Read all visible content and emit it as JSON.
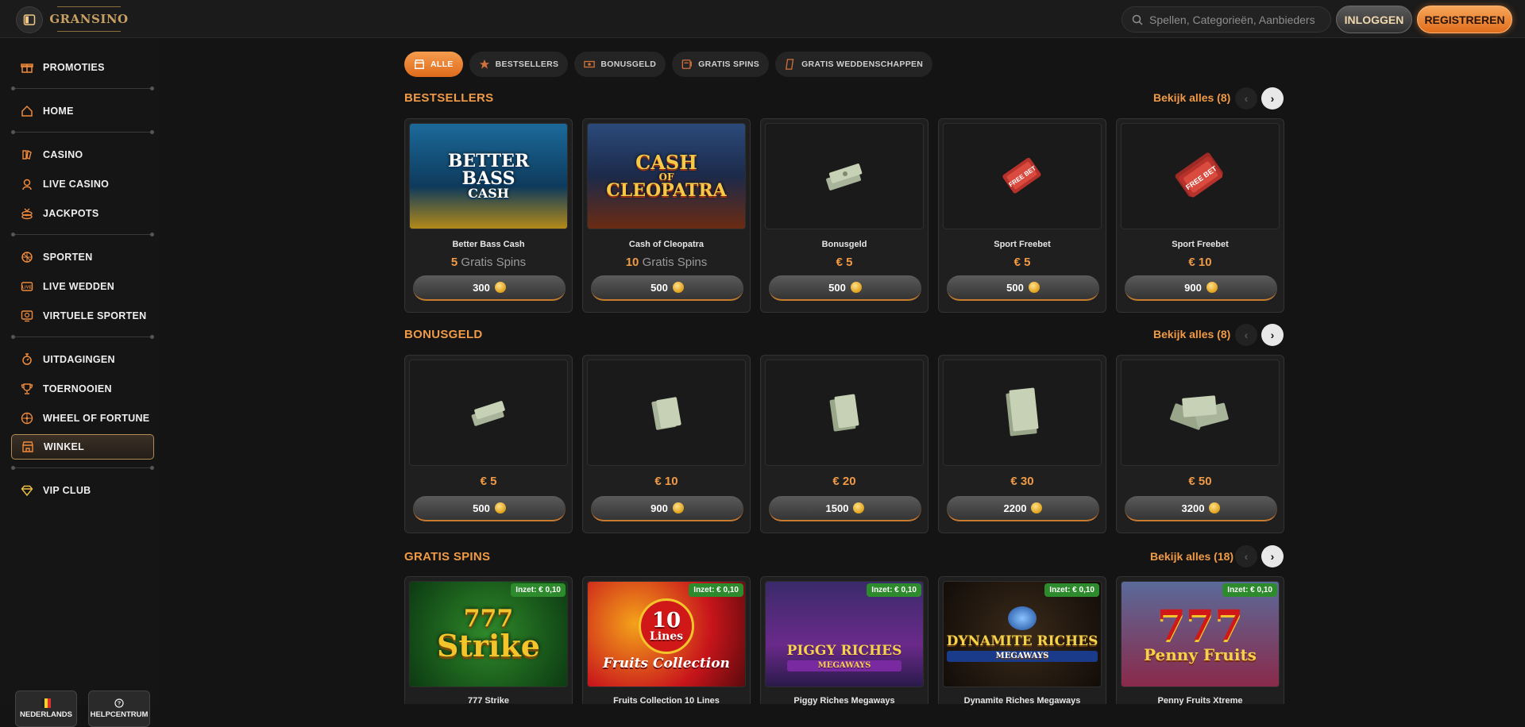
{
  "header": {
    "logo_text": "GRANSINO",
    "search_placeholder": "Spellen, Categorieën, Aanbieders",
    "login_label": "INLOGGEN",
    "register_label": "REGISTREREN"
  },
  "sidebar": {
    "items": [
      {
        "label": "PROMOTIES",
        "icon": "gift-icon"
      },
      {
        "label": "HOME",
        "icon": "home-icon"
      },
      {
        "label": "CASINO",
        "icon": "casino-icon"
      },
      {
        "label": "LIVE CASINO",
        "icon": "live-casino-icon"
      },
      {
        "label": "JACKPOTS",
        "icon": "jackpot-icon"
      },
      {
        "label": "SPORTEN",
        "icon": "sports-ball-icon"
      },
      {
        "label": "LIVE WEDDEN",
        "icon": "live-betting-icon"
      },
      {
        "label": "VIRTUELE SPORTEN",
        "icon": "virtual-sports-icon"
      },
      {
        "label": "UITDAGINGEN",
        "icon": "challenge-icon"
      },
      {
        "label": "TOERNOOIEN",
        "icon": "trophy-icon"
      },
      {
        "label": "WHEEL OF FORTUNE",
        "icon": "wheel-icon"
      },
      {
        "label": "WINKEL",
        "icon": "shop-icon"
      },
      {
        "label": "VIP CLUB",
        "icon": "diamond-icon"
      }
    ],
    "language_label": "NEDERLANDS",
    "help_label": "HELPCENTRUM"
  },
  "filters": [
    {
      "label": "ALLE",
      "icon": "shop-icon"
    },
    {
      "label": "BESTSELLERS",
      "icon": "star-icon"
    },
    {
      "label": "BONUSGELD",
      "icon": "cash-icon"
    },
    {
      "label": "GRATIS SPINS",
      "icon": "spins-icon"
    },
    {
      "label": "GRATIS WEDDENSCHAPPEN",
      "icon": "ticket-icon"
    }
  ],
  "sections": {
    "bestsellers": {
      "title": "BESTSELLERS",
      "see_all": "Bekijk alles (8)",
      "cards": [
        {
          "name": "Better Bass Cash",
          "count": "5",
          "unit": "Gratis Spins",
          "price": "300"
        },
        {
          "name": "Cash of Cleopatra",
          "count": "10",
          "unit": "Gratis Spins",
          "price": "500"
        },
        {
          "name": "Bonusgeld",
          "amount": "€ 5",
          "price": "500"
        },
        {
          "name": "Sport Freebet",
          "amount": "€ 5",
          "price": "500"
        },
        {
          "name": "Sport Freebet",
          "amount": "€ 10",
          "price": "900"
        }
      ]
    },
    "bonusgeld": {
      "title": "BONUSGELD",
      "see_all": "Bekijk alles (8)",
      "cards": [
        {
          "amount": "€ 5",
          "price": "500"
        },
        {
          "amount": "€ 10",
          "price": "900"
        },
        {
          "amount": "€ 20",
          "price": "1500"
        },
        {
          "amount": "€ 30",
          "price": "2200"
        },
        {
          "amount": "€ 50",
          "price": "3200"
        }
      ]
    },
    "gratis_spins": {
      "title": "GRATIS SPINS",
      "see_all": "Bekijk alles (18)",
      "cards": [
        {
          "name": "777 Strike",
          "badge": "Inzet: € 0,10"
        },
        {
          "name": "Fruits Collection 10 Lines",
          "badge": "Inzet: € 0,10"
        },
        {
          "name": "Piggy Riches Megaways",
          "badge": "Inzet: € 0,10"
        },
        {
          "name": "Dynamite Riches Megaways",
          "badge": "Inzet: € 0,10"
        },
        {
          "name": "Penny Fruits Xtreme",
          "badge": "Inzet: € 0,10"
        }
      ]
    }
  },
  "game_art_text": {
    "better_bass_cash": [
      "BETTER",
      "BASS",
      "CASH"
    ],
    "cash_of_cleopatra": [
      "CASH",
      "OF",
      "CLEOPATRA"
    ],
    "freebet": "FREE BET",
    "strike": [
      "777",
      "Strike"
    ],
    "fruits": [
      "10",
      "Lines",
      "Fruits Collection"
    ],
    "piggy": [
      "PIGGY RICHES",
      "MEGAWAYS"
    ],
    "dynamite": [
      "DYNAMITE RICHES",
      "MEGAWAYS"
    ],
    "penny": [
      "777",
      "Penny Fruits"
    ]
  },
  "colors": {
    "accent": "#f09a46",
    "register_btn": "#e8842f",
    "badge_green": "#2d8a2d",
    "background": "#141414"
  }
}
